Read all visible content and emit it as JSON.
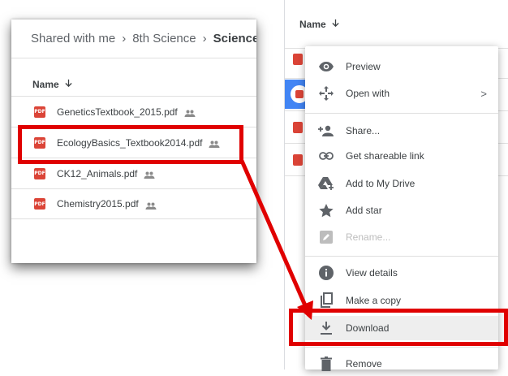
{
  "breadcrumb": {
    "items": [
      "Shared with me",
      "8th Science",
      "Science"
    ]
  },
  "left_list": {
    "header": "Name",
    "files": [
      {
        "name": "GeneticsTextbook_2015.pdf",
        "icon": "pdf-icon"
      },
      {
        "name": "EcologyBasics_Textbook2014.pdf",
        "icon": "pdf-icon"
      },
      {
        "name": "CK12_Animals.pdf",
        "icon": "pdf-icon"
      },
      {
        "name": "Chemistry2015.pdf",
        "icon": "pdf-icon"
      }
    ],
    "pdf_badge": "PDF"
  },
  "right_list": {
    "header": "Name"
  },
  "context_menu": {
    "items": [
      {
        "label": "Preview",
        "icon": "eye-icon"
      },
      {
        "label": "Open with",
        "icon": "move-icon",
        "submenu": ">"
      },
      {
        "label": "Share...",
        "icon": "add-person-icon"
      },
      {
        "label": "Get shareable link",
        "icon": "link-icon"
      },
      {
        "label": "Add to My Drive",
        "icon": "drive-add-icon"
      },
      {
        "label": "Add star",
        "icon": "star-icon"
      },
      {
        "label": "Rename...",
        "icon": "pencil-icon"
      },
      {
        "label": "View details",
        "icon": "info-icon"
      },
      {
        "label": "Make a copy",
        "icon": "copy-icon"
      },
      {
        "label": "Download",
        "icon": "download-icon"
      },
      {
        "label": "Remove",
        "icon": "trash-icon"
      }
    ]
  },
  "colors": {
    "annotation_red": "#e00000",
    "pdf_red": "#db4437",
    "selection_blue": "#4285f4"
  }
}
